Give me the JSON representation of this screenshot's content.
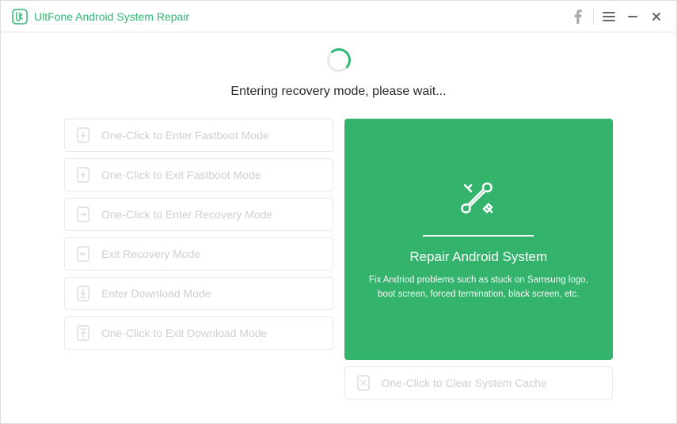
{
  "titlebar": {
    "app_name": "UltFone Android System Repair"
  },
  "status": {
    "message": "Entering recovery mode, please wait..."
  },
  "options": {
    "enter_fastboot": "One-Click to Enter Fastboot Mode",
    "exit_fastboot": "One-Click to Exit Fastboot Mode",
    "enter_recovery": "One-Click to Enter Recovery Mode",
    "exit_recovery": "Exit Recovery Mode",
    "enter_download": "Enter Download Mode",
    "exit_download": "One-Click to Exit Download Mode",
    "clear_cache": "One-Click to Clear System Cache"
  },
  "repair_card": {
    "title": "Repair Android System",
    "desc": "Fix Andriod problems such as stuck on Samsung logo, boot screen, forced termination, black screen, etc."
  }
}
